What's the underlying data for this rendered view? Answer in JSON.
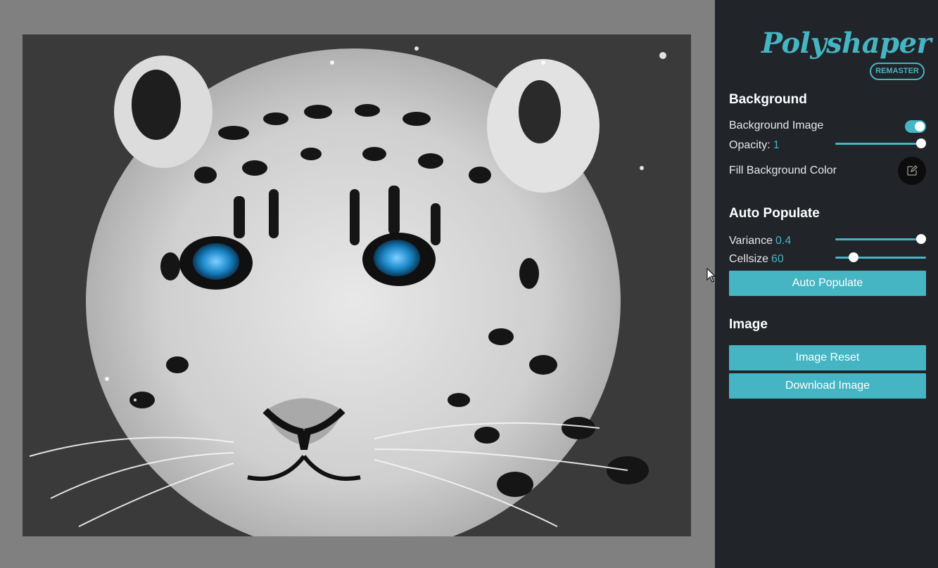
{
  "app": {
    "logo": "Polyshaper",
    "badge": "REMASTER",
    "accent_color": "#45b5c4"
  },
  "background": {
    "title": "Background",
    "image_label": "Background Image",
    "image_enabled": true,
    "opacity_label": "Opacity:",
    "opacity_value": "1",
    "fill_label": "Fill Background Color",
    "fill_color": "#000000"
  },
  "auto_populate": {
    "title": "Auto Populate",
    "variance_label": "Variance",
    "variance_value": "0.4",
    "cellsize_label": "Cellsize",
    "cellsize_value": "60",
    "button_label": "Auto Populate"
  },
  "image": {
    "title": "Image",
    "reset_label": "Image Reset",
    "download_label": "Download Image"
  },
  "icons": {
    "fill_color_icon": "edit-icon",
    "cursor": "mouse-pointer-icon"
  }
}
